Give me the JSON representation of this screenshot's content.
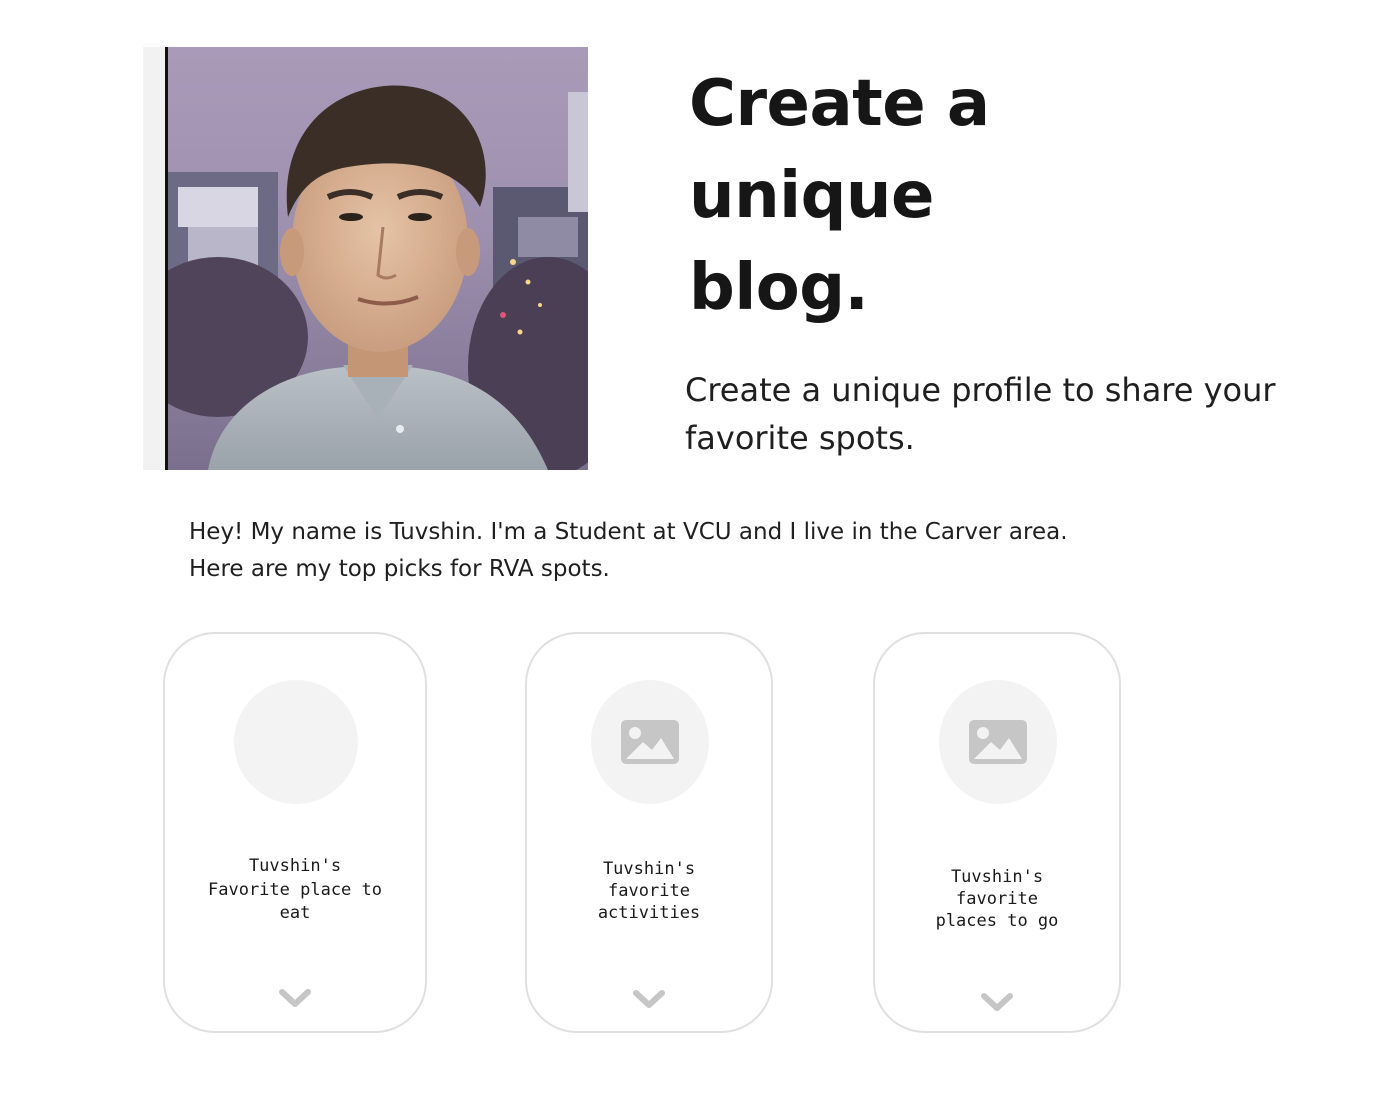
{
  "hero": {
    "headline": "Create a unique blog.",
    "subhead": "Create a unique profile to share your favorite spots."
  },
  "profile": {
    "photo_icon": "portrait-photo",
    "bio": "Hey! My name is Tuvshin. I'm a Student at VCU and I live in the Carver area. Here are my top picks for RVA spots."
  },
  "cards": [
    {
      "title": "Tuvshin's Favorite place to eat",
      "image_icon": "blank-circle",
      "toggle_icon": "chevron-down-icon"
    },
    {
      "title": "Tuvshin's favorite activities",
      "image_icon": "image-placeholder-icon",
      "toggle_icon": "chevron-down-icon"
    },
    {
      "title": "Tuvshin's favorite places to go",
      "image_icon": "image-placeholder-icon",
      "toggle_icon": "chevron-down-icon"
    }
  ],
  "colors": {
    "text": "#161616",
    "card_border": "#e0e0e0",
    "placeholder_bg": "#f3f3f3",
    "icon_gray": "#c6c6c6"
  }
}
